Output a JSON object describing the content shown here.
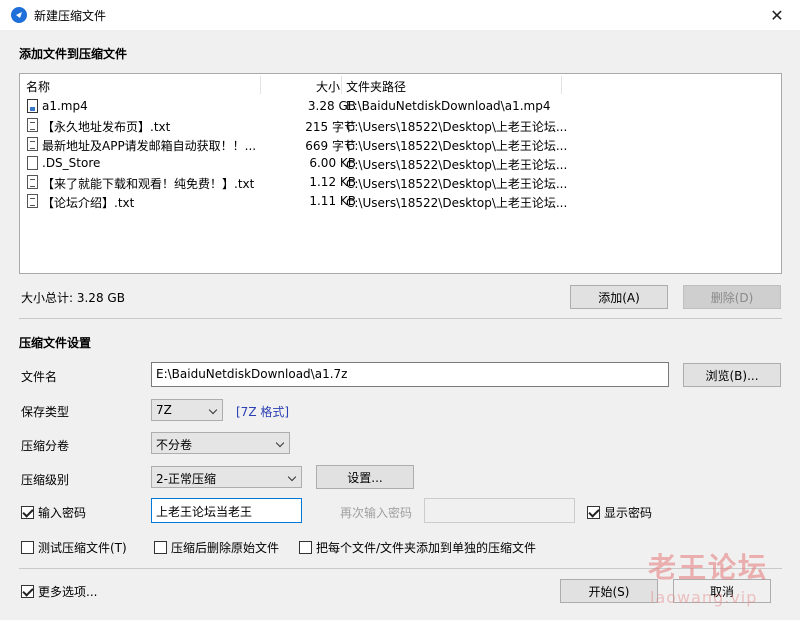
{
  "window": {
    "title": "新建压缩文件",
    "close": "✕"
  },
  "files_section": {
    "title": "添加文件到压缩文件"
  },
  "file_list": {
    "columns": {
      "name": "名称",
      "size": "大小",
      "path": "文件夹路径"
    },
    "rows": [
      {
        "name": "a1.mp4",
        "size": "3.28 GB",
        "path": "E:\\BaiduNetdiskDownload\\a1.mp4",
        "icon": "video-file-icon"
      },
      {
        "name": "【永久地址发布页】.txt",
        "size": "215 字节",
        "path": "C:\\Users\\18522\\Desktop\\上老王论坛...",
        "icon": "text-file-icon"
      },
      {
        "name": "最新地址及APP请发邮箱自动获取！！...",
        "size": "669 字节",
        "path": "C:\\Users\\18522\\Desktop\\上老王论坛...",
        "icon": "text-file-icon"
      },
      {
        "name": ".DS_Store",
        "size": "6.00 KB",
        "path": "C:\\Users\\18522\\Desktop\\上老王论坛...",
        "icon": "blank-file-icon"
      },
      {
        "name": "【来了就能下载和观看！纯免费！】.txt",
        "size": "1.12 KB",
        "path": "C:\\Users\\18522\\Desktop\\上老王论坛...",
        "icon": "text-file-icon"
      },
      {
        "name": "【论坛介绍】.txt",
        "size": "1.11 KB",
        "path": "C:\\Users\\18522\\Desktop\\上老王论坛...",
        "icon": "text-file-icon"
      }
    ]
  },
  "total_size": "大小总计: 3.28 GB",
  "buttons": {
    "add": "添加(A)",
    "delete": "删除(D)",
    "browse": "浏览(B)...",
    "settings": "设置...",
    "start": "开始(S)",
    "cancel": "取消"
  },
  "settings_section": {
    "title": "压缩文件设置"
  },
  "fields": {
    "filename_label": "文件名",
    "filename_value": "E:\\BaiduNetdiskDownload\\a1.7z",
    "save_type_label": "保存类型",
    "save_type_value": "7Z",
    "save_type_link": "[7Z 格式]",
    "split_label": "压缩分卷",
    "split_value": "不分卷",
    "level_label": "压缩级别",
    "level_value": "2-正常压缩",
    "password_label": "输入密码",
    "password_value": "上老王论坛当老王",
    "reenter_label": "再次输入密码",
    "show_password_label": "显示密码"
  },
  "options": {
    "test_archive": "测试压缩文件(T)",
    "delete_after": "压缩后删除原始文件",
    "each_separate": "把每个文件/文件夹添加到单独的压缩文件",
    "more_options": "更多选项..."
  },
  "checked": {
    "password": true,
    "show_password": true,
    "test_archive": false,
    "delete_after": false,
    "each_separate": false,
    "more_options": true
  },
  "watermark": {
    "main": "老王论坛",
    "sub": "laowang.vip"
  },
  "colors": {
    "accent": "#0078d7",
    "link": "#2b3fb5",
    "watermark": "#e67878"
  }
}
